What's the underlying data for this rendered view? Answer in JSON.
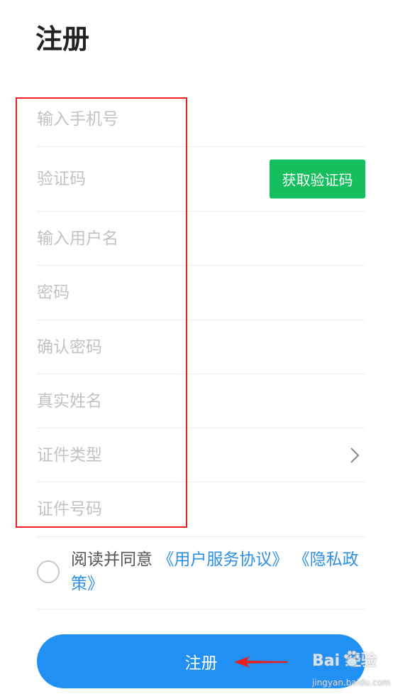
{
  "page": {
    "title": "注册"
  },
  "form": {
    "fields": [
      {
        "placeholder": "输入手机号",
        "value": ""
      },
      {
        "placeholder": "验证码",
        "value": ""
      },
      {
        "placeholder": "输入用户名",
        "value": ""
      },
      {
        "placeholder": "密码",
        "value": ""
      },
      {
        "placeholder": "确认密码",
        "value": ""
      },
      {
        "placeholder": "真实姓名",
        "value": ""
      },
      {
        "placeholder": "证件类型",
        "value": ""
      },
      {
        "placeholder": "证件号码",
        "value": ""
      }
    ],
    "get_code_label": "获取验证码"
  },
  "agreement": {
    "prefix": "阅读并同意",
    "user_agreement": "《用户服务协议》",
    "privacy_policy": "《隐私政策》",
    "checked": false
  },
  "submit": {
    "label": "注册"
  },
  "watermark": {
    "logo": "Bai 经验",
    "url": "jingyan.baidu.com"
  },
  "colors": {
    "primary": "#2090f5",
    "get_code": "#16bf5d",
    "link": "#2d8fe6",
    "annotation": "#e8211e",
    "placeholder": "#c2c2c2",
    "divider": "#eeeeee"
  },
  "icons": {
    "id_type_chevron": "chevron-right-icon",
    "agreement_radio": "radio-unchecked-icon",
    "watermark": "baidu-paw-icon"
  }
}
